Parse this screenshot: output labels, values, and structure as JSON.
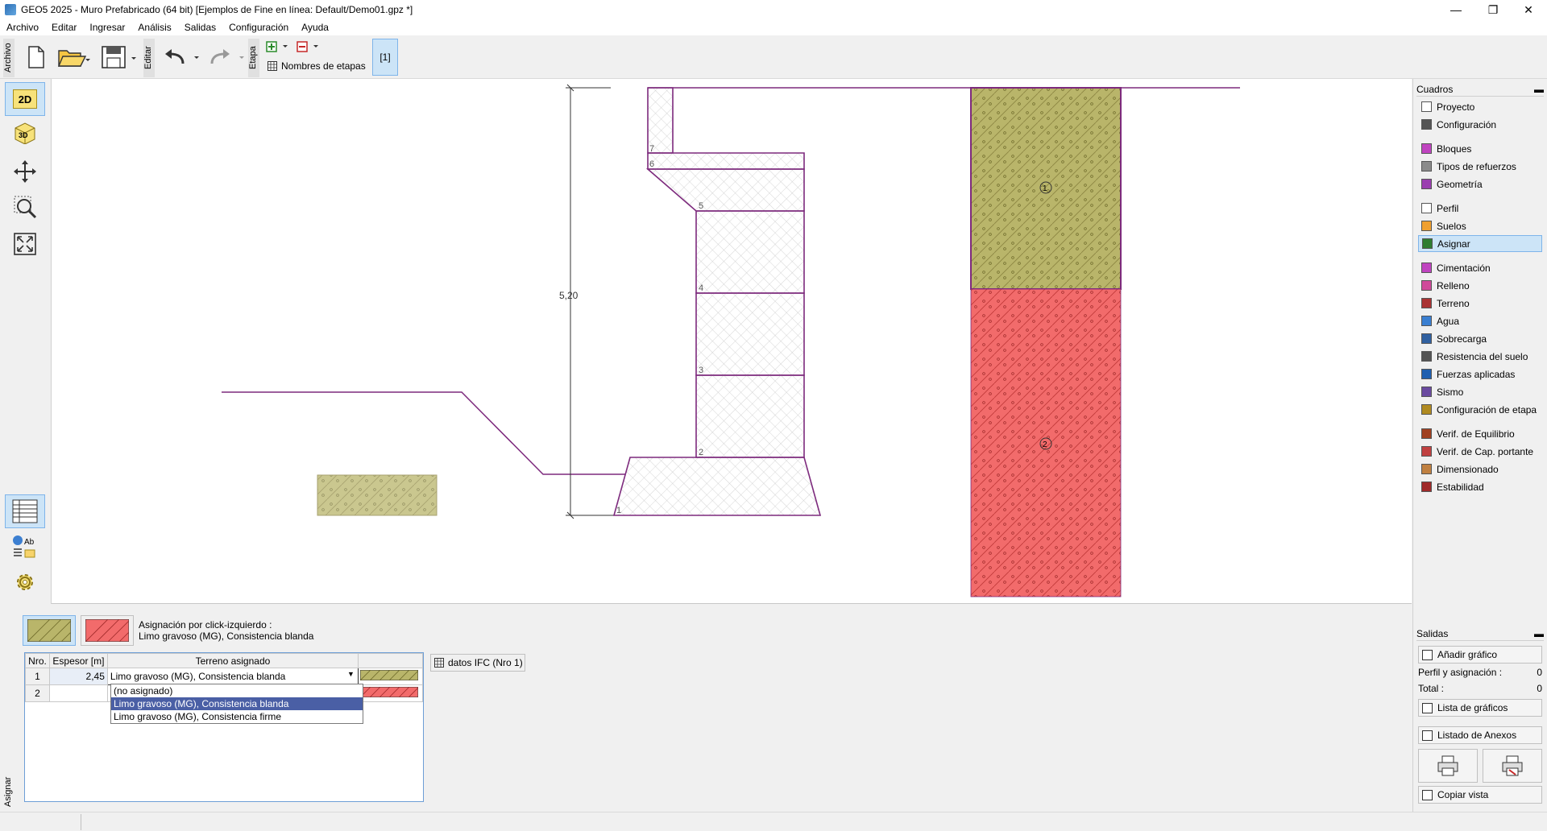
{
  "window": {
    "title": "GEO5 2025 - Muro Prefabricado (64 bit) [Ejemplos de Fine en línea: Default/Demo01.gpz *]",
    "min": "—",
    "max": "❐",
    "close": "✕"
  },
  "menu": [
    "Archivo",
    "Editar",
    "Ingresar",
    "Análisis",
    "Salidas",
    "Configuración",
    "Ayuda"
  ],
  "toolbar": {
    "archivo_label": "Archivo",
    "editar_label": "Editar",
    "etapa_label": "Etapa",
    "stage_names": "Nombres de etapas",
    "stage_button": "[1]"
  },
  "leftrail": {
    "btn_2d": "2D",
    "btn_3d": "3D"
  },
  "drawing": {
    "dimension_label": "5,20",
    "block_numbers": [
      "7",
      "6",
      "5",
      "4",
      "3",
      "2",
      "1"
    ],
    "soil_numbers": [
      "1",
      "2"
    ],
    "colors": {
      "soil1": "#b9b56a",
      "soil2": "#f26b6b",
      "wall": "#7d2a7d"
    }
  },
  "cuadros": {
    "title": "Cuadros",
    "items": [
      {
        "label": "Proyecto",
        "icon": "document-icon"
      },
      {
        "label": "Configuración",
        "icon": "gear-icon"
      },
      {
        "label": "Bloques",
        "icon": "block-icon"
      },
      {
        "label": "Tipos de refuerzos",
        "icon": "reinforcement-icon"
      },
      {
        "label": "Geometría",
        "icon": "geometry-icon"
      },
      {
        "label": "Perfil",
        "icon": "profile-icon"
      },
      {
        "label": "Suelos",
        "icon": "soil-icon"
      },
      {
        "label": "Asignar",
        "icon": "assign-icon"
      },
      {
        "label": "Cimentación",
        "icon": "foundation-icon"
      },
      {
        "label": "Relleno",
        "icon": "backfill-icon"
      },
      {
        "label": "Terreno",
        "icon": "terrain-icon"
      },
      {
        "label": "Agua",
        "icon": "water-icon"
      },
      {
        "label": "Sobrecarga",
        "icon": "surcharge-icon"
      },
      {
        "label": "Resistencia del suelo",
        "icon": "resistance-icon"
      },
      {
        "label": "Fuerzas aplicadas",
        "icon": "force-icon"
      },
      {
        "label": "Sismo",
        "icon": "earthquake-icon"
      },
      {
        "label": "Configuración de etapa",
        "icon": "stage-settings-icon"
      },
      {
        "label": "Verif. de Equilibrio",
        "icon": "equilibrium-icon"
      },
      {
        "label": "Verif. de Cap. portante",
        "icon": "bearing-icon"
      },
      {
        "label": "Dimensionado",
        "icon": "dimensioning-icon"
      },
      {
        "label": "Estabilidad",
        "icon": "stability-icon"
      }
    ],
    "selected": "Asignar"
  },
  "salidas": {
    "title": "Salidas",
    "add_graph": "Añadir gráfico",
    "perfil_label": "Perfil y asignación :",
    "perfil_value": "0",
    "total_label": "Total :",
    "total_value": "0",
    "list_graphs": "Lista de gráficos",
    "annex_list": "Listado de Anexos",
    "copy_view": "Copiar vista"
  },
  "assign_panel": {
    "side_label": "Asignar",
    "info_line1": "Asignación por click-izquierdo :",
    "info_line2": "Limo gravoso (MG), Consistencia blanda",
    "ifc_button": "datos IFC  (Nro 1)",
    "columns": [
      "Nro.",
      "Espesor [m]",
      "Terreno asignado"
    ],
    "rows": [
      {
        "nro": "1",
        "espesor": "2,45",
        "terreno": "Limo gravoso (MG), Consistencia blanda"
      },
      {
        "nro": "2",
        "espesor": "",
        "terreno": ""
      }
    ],
    "dropdown_options": [
      "(no asignado)",
      "Limo gravoso (MG), Consistencia blanda",
      "Limo gravoso (MG), Consistencia firme"
    ],
    "dropdown_highlighted": 1
  }
}
